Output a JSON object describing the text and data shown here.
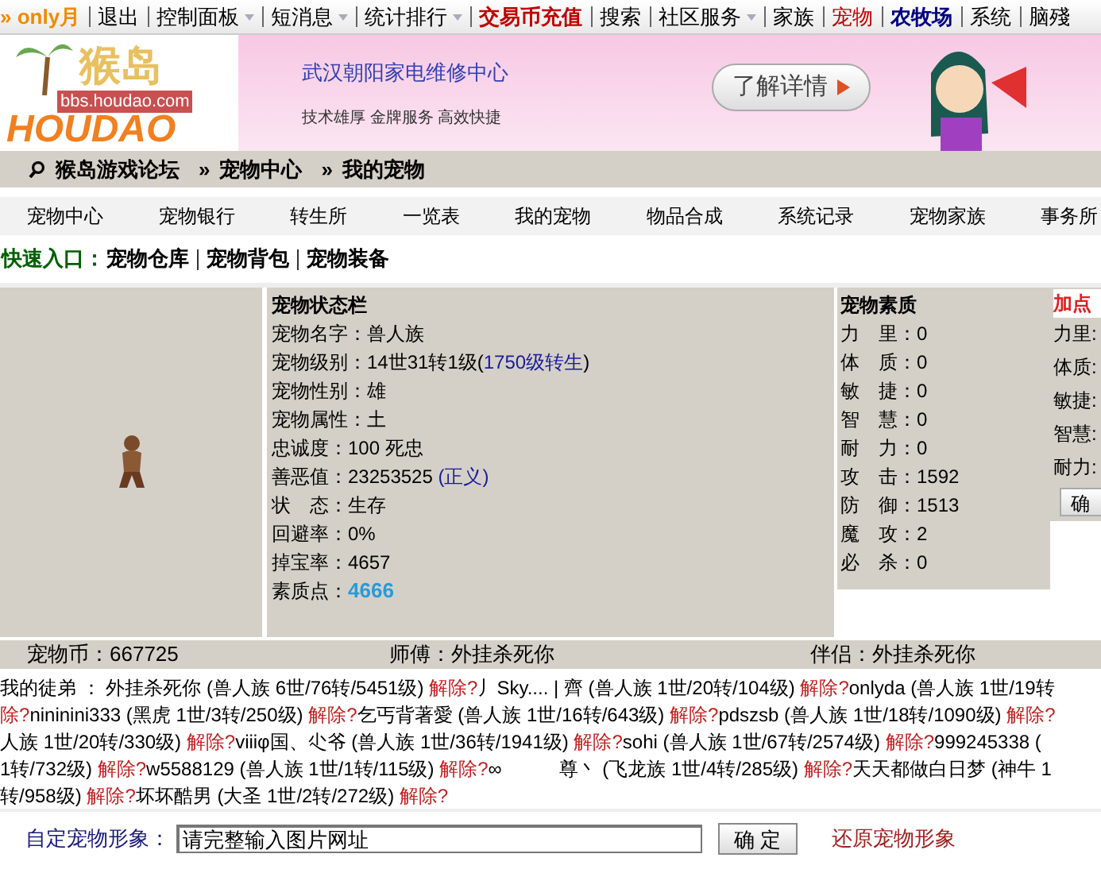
{
  "top_nav": [
    {
      "label": "» only月",
      "kind": "user",
      "caret": false
    },
    {
      "label": "退出",
      "kind": "plain",
      "caret": false
    },
    {
      "label": "控制面板",
      "kind": "plain",
      "caret": true
    },
    {
      "label": "短消息",
      "kind": "plain",
      "caret": true
    },
    {
      "label": "统计排行",
      "kind": "plain",
      "caret": true
    },
    {
      "label": "交易币充值",
      "kind": "hot",
      "caret": false
    },
    {
      "label": "搜索",
      "kind": "plain",
      "caret": false
    },
    {
      "label": "社区服务",
      "kind": "plain",
      "caret": true
    },
    {
      "label": "家族",
      "kind": "plain",
      "caret": false
    },
    {
      "label": "宠物",
      "kind": "red",
      "caret": false
    },
    {
      "label": "农牧场",
      "kind": "blue",
      "caret": false
    },
    {
      "label": "系统",
      "kind": "plain",
      "caret": false
    },
    {
      "label": "脑殘",
      "kind": "plain",
      "caret": false
    }
  ],
  "logo": {
    "name": "猴岛",
    "url": "bbs.houdao.com",
    "word": "HOUDAO"
  },
  "banner": {
    "title": "武汉朝阳家电维修中心",
    "slogan": "技术雄厚 金牌服务 高效快捷",
    "button": "了解详情"
  },
  "breadcrumb": {
    "separator": "»",
    "items": [
      "猴岛游戏论坛",
      "宠物中心",
      "我的宠物"
    ]
  },
  "tabs": [
    {
      "label": "宠物中心",
      "selected": false
    },
    {
      "label": "宠物银行",
      "selected": false
    },
    {
      "label": "转生所",
      "selected": false
    },
    {
      "label": "一览表",
      "selected": false
    },
    {
      "label": "我的宠物",
      "selected": false
    },
    {
      "label": "物品合成",
      "selected": false
    },
    {
      "label": "系统记录",
      "selected": false
    },
    {
      "label": "宠物家族",
      "selected": false
    },
    {
      "label": "事务所",
      "selected": false
    }
  ],
  "quick_entry": {
    "label": "快速入口：",
    "links": [
      "宠物仓库",
      "宠物背包",
      "宠物装备"
    ]
  },
  "status": {
    "title": "宠物状态栏",
    "rows": [
      {
        "label": "宠物名字：",
        "value": "兽人族",
        "kind": "plain"
      },
      {
        "label": "宠物级别：",
        "value": "14世31转1级(",
        "link": "1750级转生",
        "suffix": ")",
        "kind": "link"
      },
      {
        "label": "宠物性别：",
        "value": "雄",
        "kind": "plain"
      },
      {
        "label": "宠物属性：",
        "value": "土",
        "kind": "plain"
      },
      {
        "label": "忠诚度：",
        "value": "100 死忠",
        "kind": "plain"
      },
      {
        "label": "善恶值：",
        "value": "23253525 ",
        "link": "(正义)",
        "kind": "link"
      },
      {
        "label": "状　态：",
        "value": "生存",
        "kind": "plain"
      },
      {
        "label": "回避率：",
        "value": "0%",
        "kind": "plain"
      },
      {
        "label": "掉宝率：",
        "value": "4657",
        "kind": "plain"
      },
      {
        "label": "素质点：",
        "value": "4666",
        "kind": "highlight"
      }
    ]
  },
  "quality": {
    "title": "宠物素质",
    "rows": [
      {
        "label": "力　里：",
        "value": "0"
      },
      {
        "label": "体　质：",
        "value": "0"
      },
      {
        "label": "敏　捷：",
        "value": "0"
      },
      {
        "label": "智　慧：",
        "value": "0"
      },
      {
        "label": "耐　力：",
        "value": "0"
      },
      {
        "label": "攻　击：",
        "value": "1592"
      },
      {
        "label": "防　御：",
        "value": "1513"
      },
      {
        "label": "魔　攻：",
        "value": "2"
      },
      {
        "label": "必　杀：",
        "value": "0"
      }
    ]
  },
  "add_points": {
    "title": "加点",
    "fields": [
      "力里:",
      "体质:",
      "敏捷:",
      "智慧:",
      "耐力:"
    ],
    "button": "确"
  },
  "info_bar": {
    "coins": "宠物币：667725",
    "master": "师傅：外挂杀死你",
    "partner": "伴侣：外挂杀死你"
  },
  "disciples": [
    [
      {
        "text": "我的徒弟 ： 外挂杀死你 (兽人族 6世/76转/5451级) ",
        "kind": "plain"
      },
      {
        "text": "解除?",
        "kind": "release"
      },
      {
        "text": "丿Sky.... | 齊 (兽人族 1世/20转/104级) ",
        "kind": "plain"
      },
      {
        "text": "解除?",
        "kind": "release"
      },
      {
        "text": "onlyda (兽人族 1世/19转",
        "kind": "plain"
      }
    ],
    [
      {
        "text": "除?",
        "kind": "release"
      },
      {
        "text": "nininini333 (黑虎 1世/3转/250级) ",
        "kind": "plain"
      },
      {
        "text": "解除?",
        "kind": "release"
      },
      {
        "text": "乞丐背著愛 (兽人族 1世/16转/643级) ",
        "kind": "plain"
      },
      {
        "text": "解除?",
        "kind": "release"
      },
      {
        "text": "pdszsb (兽人族 1世/18转/1090级) ",
        "kind": "plain"
      },
      {
        "text": "解除?",
        "kind": "release"
      }
    ],
    [
      {
        "text": "人族 1世/20转/330级) ",
        "kind": "plain"
      },
      {
        "text": "解除?",
        "kind": "release"
      },
      {
        "text": "viiiφ国、尐爷 (兽人族 1世/36转/1941级) ",
        "kind": "plain"
      },
      {
        "text": "解除?",
        "kind": "release"
      },
      {
        "text": "sohi (兽人族 1世/67转/2574级) ",
        "kind": "plain"
      },
      {
        "text": "解除?",
        "kind": "release"
      },
      {
        "text": "999245338 (",
        "kind": "plain"
      }
    ],
    [
      {
        "text": "1转/732级) ",
        "kind": "plain"
      },
      {
        "text": "解除?",
        "kind": "release"
      },
      {
        "text": "w5588129 (兽人族 1世/1转/115级) ",
        "kind": "plain"
      },
      {
        "text": "解除?",
        "kind": "release"
      },
      {
        "text": "∞",
        "kind": "plain"
      },
      {
        "text": "尊丶 (飞龙族 1世/4转/285级) ",
        "kind": "spaced"
      },
      {
        "text": "解除?",
        "kind": "release"
      },
      {
        "text": "天天都做白日梦 (神牛 1",
        "kind": "plain"
      }
    ],
    [
      {
        "text": "转/958级) ",
        "kind": "plain"
      },
      {
        "text": "解除?",
        "kind": "release"
      },
      {
        "text": "坏坏酷男 (大圣 1世/2转/272级) ",
        "kind": "plain"
      },
      {
        "text": "解除?",
        "kind": "release"
      }
    ]
  ],
  "custom_image": {
    "label": "自定宠物形象：",
    "value": "请完整输入图片网址",
    "button": "确 定",
    "restore": "还原宠物形象"
  }
}
